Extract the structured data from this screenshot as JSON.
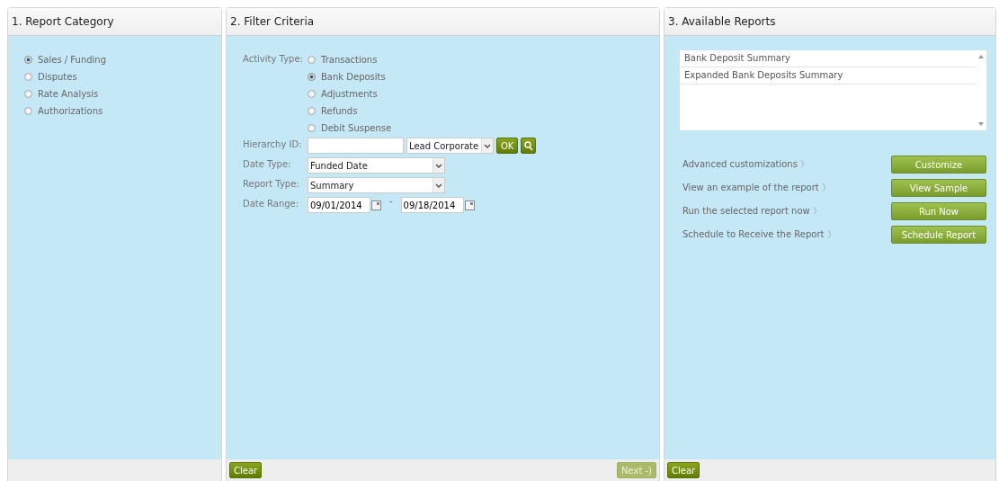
{
  "panels": {
    "category": {
      "title": "1. Report Category",
      "options": [
        {
          "label": "Sales / Funding",
          "selected": true
        },
        {
          "label": "Disputes",
          "selected": false
        },
        {
          "label": "Rate Analysis",
          "selected": false
        },
        {
          "label": "Authorizations",
          "selected": false
        }
      ]
    },
    "filter": {
      "title": "2. Filter Criteria",
      "activity_label": "Activity Type:",
      "activity_options": [
        {
          "label": "Transactions",
          "selected": false
        },
        {
          "label": "Bank Deposits",
          "selected": true
        },
        {
          "label": "Adjustments",
          "selected": false
        },
        {
          "label": "Refunds",
          "selected": false
        },
        {
          "label": "Debit Suspense",
          "selected": false
        }
      ],
      "hierarchy": {
        "label": "Hierarchy ID:",
        "level_select": "Lead Corporate",
        "ok_button": "OK"
      },
      "date_type": {
        "label": "Date Type:",
        "value": "Funded Date"
      },
      "report_type": {
        "label": "Report Type:",
        "value": "Summary"
      },
      "date_range": {
        "label": "Date Range:",
        "from": "09/01/2014",
        "separator": "-",
        "to": "09/18/2014"
      },
      "footer": {
        "clear_button": "Clear",
        "next_button": {
          "label": "Next -)",
          "disabled": true
        }
      }
    },
    "reports": {
      "title": "3. Available Reports",
      "list": [
        {
          "label": "Bank Deposit Summary",
          "selected": false
        },
        {
          "label": "Expanded Bank Deposits Summary",
          "selected": false
        }
      ],
      "actions": [
        {
          "text": "Advanced customizations 〉",
          "button": "Customize"
        },
        {
          "text": "View an example of the report 〉",
          "button": "View Sample"
        },
        {
          "text": "Run the selected report now 〉",
          "button": "Run Now"
        },
        {
          "text": "Schedule to Receive the Report 〉",
          "button": "Schedule Report"
        }
      ],
      "footer": {
        "clear_button": "Clear"
      }
    }
  }
}
